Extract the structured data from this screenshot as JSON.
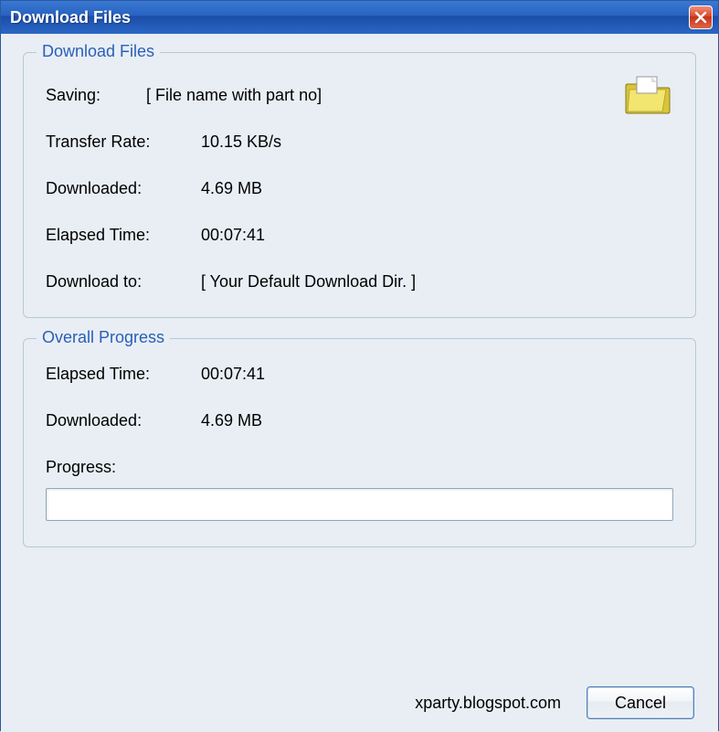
{
  "window": {
    "title": "Download Files"
  },
  "downloadGroup": {
    "title": "Download Files",
    "savingLabel": "Saving:",
    "savingValue": "[ File name with part no]",
    "transferRateLabel": "Transfer Rate:",
    "transferRateValue": "10.15 KB/s",
    "downloadedLabel": "Downloaded:",
    "downloadedValue": "4.69 MB",
    "elapsedLabel": "Elapsed Time:",
    "elapsedValue": "00:07:41",
    "downloadToLabel": "Download to:",
    "downloadToValue": "[ Your Default Download Dir. ]"
  },
  "overallGroup": {
    "title": "Overall Progress",
    "elapsedLabel": "Elapsed Time:",
    "elapsedValue": "00:07:41",
    "downloadedLabel": "Downloaded:",
    "downloadedValue": "4.69 MB",
    "progressLabel": "Progress:",
    "progressPercent": 0
  },
  "footer": {
    "attribution": "xparty.blogspot.com",
    "cancelLabel": "Cancel"
  }
}
